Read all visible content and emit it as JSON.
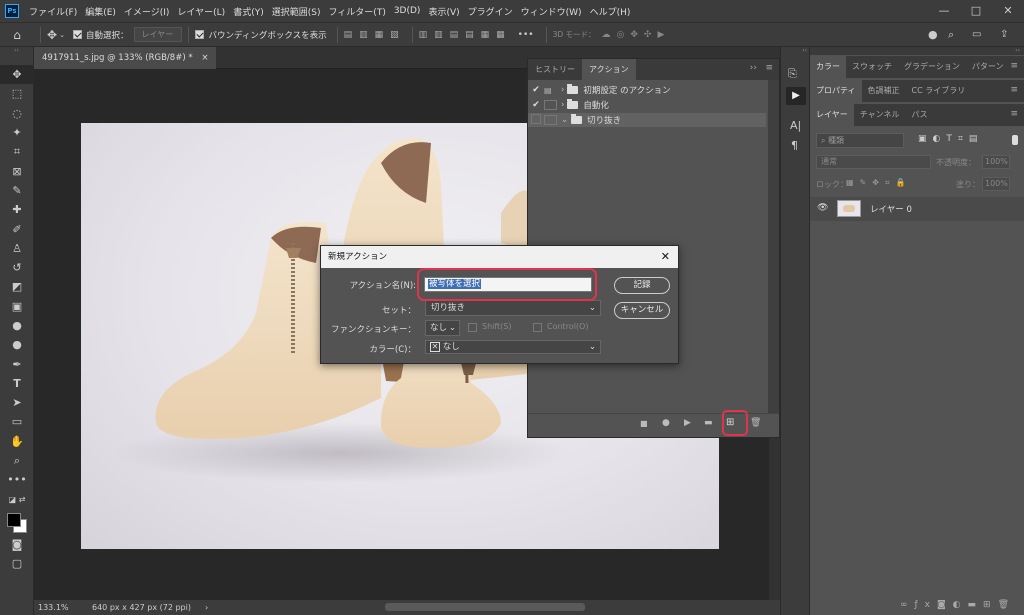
{
  "menubar": {
    "logo": "Ps",
    "items": [
      "ファイル(F)",
      "編集(E)",
      "イメージ(I)",
      "レイヤー(L)",
      "書式(Y)",
      "選択範囲(S)",
      "フィルター(T)",
      "3D(D)",
      "表示(V)",
      "プラグイン",
      "ウィンドウ(W)",
      "ヘルプ(H)"
    ],
    "minimize": "—",
    "maximize": "□",
    "close": "✕"
  },
  "options": {
    "auto_select": "自動選択：",
    "layer_dropdown": "レイヤー",
    "bounding_box": "バウンディングボックスを表示",
    "more": "•••",
    "mode_3d": "3D モード："
  },
  "document": {
    "tab": "4917911_s.jpg @ 133% (RGB/8#) *",
    "tab_close": "×",
    "zoom": "133.1%",
    "size": "640 px x 427 px (72 ppi)"
  },
  "actions_panel": {
    "tabs": [
      "ヒストリー",
      "アクション"
    ],
    "expand": "››",
    "menu": "≡",
    "rows": [
      {
        "checked": true,
        "name": "初期設定 のアクション",
        "expanded": false
      },
      {
        "checked": true,
        "name": "自動化",
        "expanded": false
      },
      {
        "checked": false,
        "name": "切り抜き",
        "expanded": true
      }
    ]
  },
  "dialog": {
    "title": "新規アクション",
    "close": "✕",
    "name_label": "アクション名(N):",
    "name_value": "被写体を選択",
    "set_label": "セット：",
    "set_value": "切り抜き",
    "fkey_label": "ファンクションキー：",
    "fkey_value": "なし",
    "shift": "Shift(S)",
    "control": "Control(O)",
    "color_label": "カラー(C)：",
    "color_value": "なし",
    "record_button": "記録",
    "cancel_button": "キャンセル"
  },
  "right_panels": {
    "row1_tabs": [
      "カラー",
      "スウォッチ",
      "グラデーション",
      "パターン"
    ],
    "row2_tabs": [
      "プロパティ",
      "色調補正",
      "CC ライブラリ"
    ],
    "row3_tabs": [
      "レイヤー",
      "チャンネル",
      "パス"
    ],
    "search_placeholder": "種類",
    "blend_mode": "通常",
    "opacity_label": "不透明度：",
    "opacity_value": "100%",
    "lock_label": "ロック：",
    "fill_label": "塗り：",
    "fill_value": "100%",
    "layer_name": "レイヤー 0"
  },
  "colors": {
    "accent_red": "#e0344d",
    "panel": "#535353",
    "dark": "#3c3c3c"
  }
}
